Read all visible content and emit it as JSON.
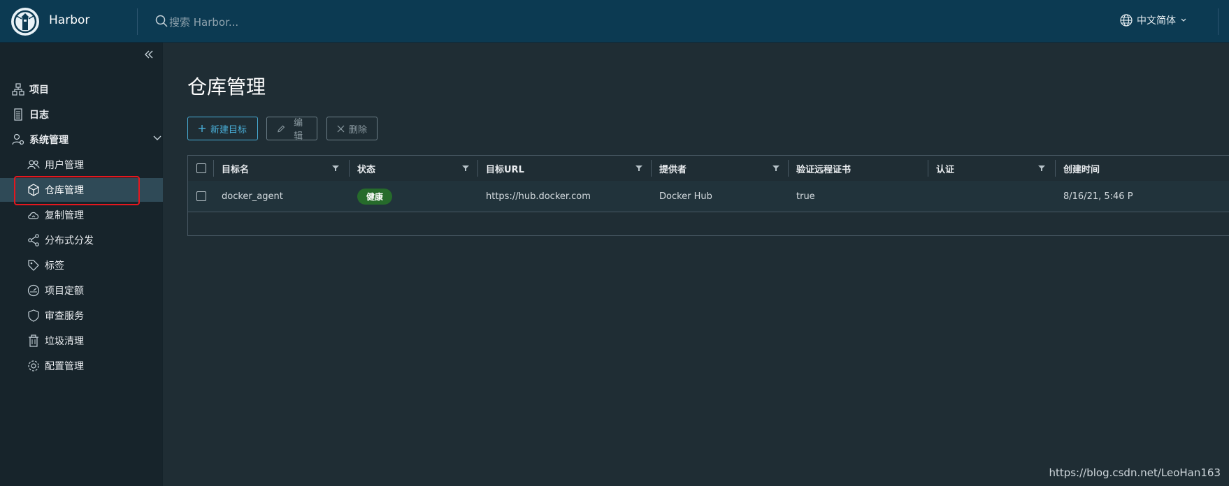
{
  "header": {
    "app_name": "Harbor",
    "search_placeholder": "搜索 Harbor...",
    "language": "中文简体"
  },
  "sidebar": {
    "collapse_icon": "double-chevron-left-icon",
    "items": [
      {
        "label": "项目",
        "icon": "project-icon"
      },
      {
        "label": "日志",
        "icon": "log-icon"
      },
      {
        "label": "系统管理",
        "icon": "admin-icon"
      }
    ],
    "sub_items": [
      {
        "label": "用户管理",
        "icon": "users-icon"
      },
      {
        "label": "仓库管理",
        "icon": "registry-icon",
        "active": true
      },
      {
        "label": "复制管理",
        "icon": "cloud-icon"
      },
      {
        "label": "分布式分发",
        "icon": "share-icon"
      },
      {
        "label": "标签",
        "icon": "tag-icon"
      },
      {
        "label": "项目定额",
        "icon": "quota-icon"
      },
      {
        "label": "审查服务",
        "icon": "shield-icon"
      },
      {
        "label": "垃圾清理",
        "icon": "trash-icon"
      },
      {
        "label": "配置管理",
        "icon": "gear-icon"
      }
    ]
  },
  "main": {
    "title": "仓库管理",
    "buttons": {
      "new": "新建目标",
      "edit": "编辑",
      "delete": "删除"
    },
    "table": {
      "headers": [
        "目标名",
        "状态",
        "目标URL",
        "提供者",
        "验证远程证书",
        "认证",
        "创建时间"
      ],
      "rows": [
        {
          "name": "docker_agent",
          "status": "健康",
          "url": "https://hub.docker.com",
          "provider": "Docker Hub",
          "verify_cert": "true",
          "auth": "",
          "created": "8/16/21, 5:46 P"
        }
      ]
    }
  },
  "watermark": "https://blog.csdn.net/LeoHan163",
  "colors": {
    "topbar": "#0c3a52",
    "sidebar": "#17242b",
    "main": "#1f2d34",
    "accent": "#49afd9",
    "status_ok": "#266b2b",
    "highlight": "#e5171e"
  }
}
